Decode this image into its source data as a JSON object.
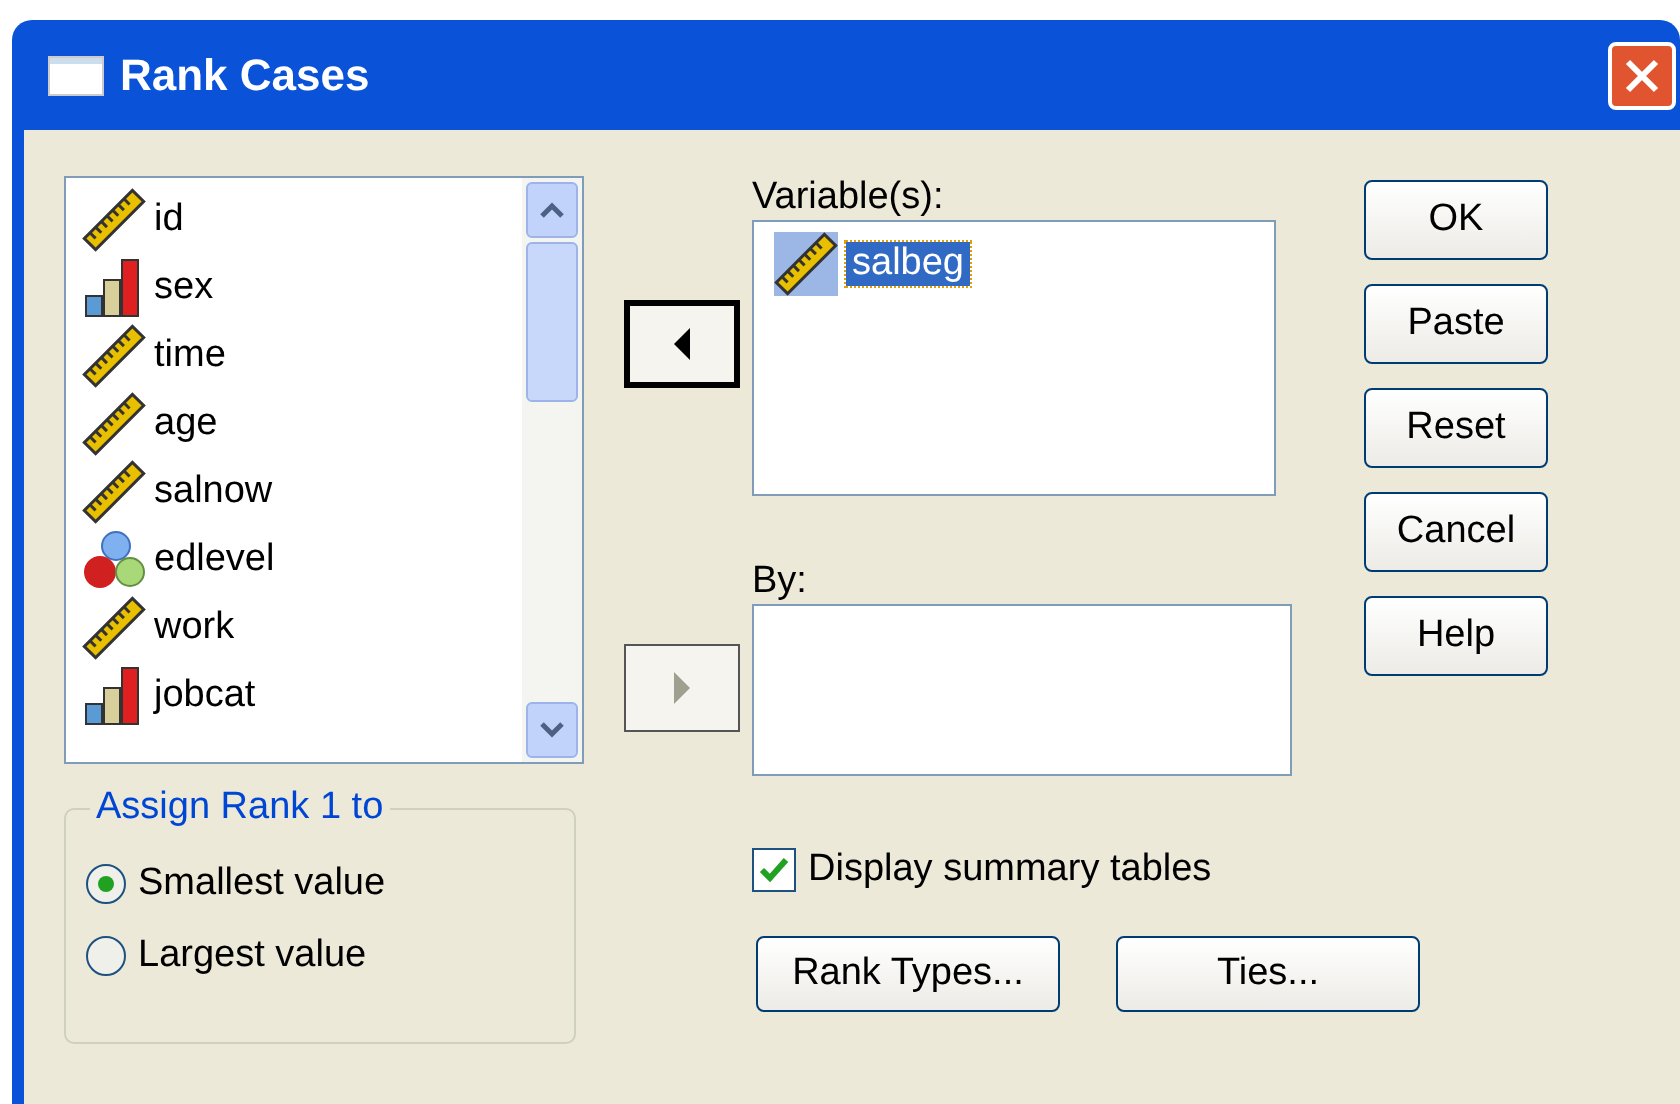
{
  "window": {
    "title": "Rank Cases"
  },
  "source_list": {
    "items": [
      {
        "name": "id",
        "kind": "scale",
        "selected": false
      },
      {
        "name": "sex",
        "kind": "ordinal",
        "selected": false
      },
      {
        "name": "time",
        "kind": "scale",
        "selected": false
      },
      {
        "name": "age",
        "kind": "scale",
        "selected": false
      },
      {
        "name": "salnow",
        "kind": "scale",
        "selected": false
      },
      {
        "name": "edlevel",
        "kind": "nominal",
        "selected": false
      },
      {
        "name": "work",
        "kind": "scale",
        "selected": false
      },
      {
        "name": "jobcat",
        "kind": "ordinal",
        "selected": false
      }
    ]
  },
  "move_buttons": [
    {
      "kind": "left",
      "disabled": false
    },
    {
      "kind": "right",
      "disabled": true
    }
  ],
  "variables": {
    "label": "Variable(s):",
    "items": [
      {
        "name": "salbeg",
        "kind": "scale",
        "selected": true
      }
    ]
  },
  "by": {
    "label": "By:"
  },
  "buttons": [
    "OK",
    "Paste",
    "Reset",
    "Cancel",
    "Help"
  ],
  "assign_rank": {
    "title": "Assign Rank 1 to",
    "options": [
      {
        "label": "Smallest value",
        "selected": true
      },
      {
        "label": "Largest value",
        "selected": false
      }
    ]
  },
  "display_summary": {
    "label": "Display summary tables",
    "checked": true
  },
  "bottom_buttons": [
    "Rank Types...",
    "Ties..."
  ]
}
